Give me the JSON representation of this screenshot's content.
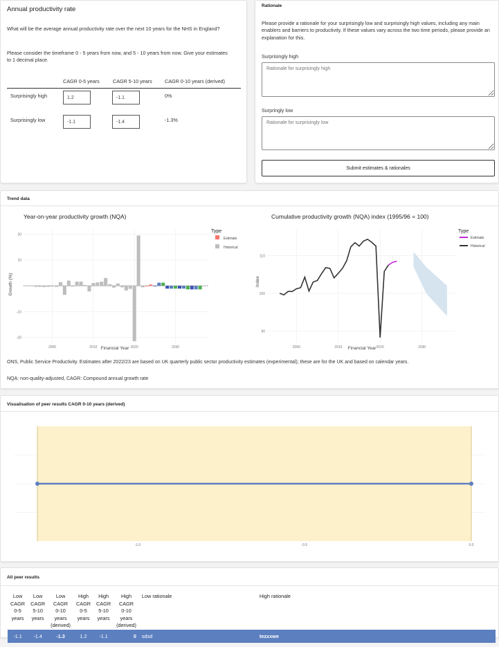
{
  "question": {
    "title": "Annual productivity rate",
    "text1": "What will be the average annual productivity rate over the next 10 years for the NHS in England?",
    "text2": "Please consider the timeframe 0 - 5 years from now, and 5 - 10 years from now. Give your estimates to 1 decimal place.",
    "columns": [
      "CAGR 0-5 years",
      "CAGR 5-10 years",
      "CAGR 0-10 years (derived)"
    ],
    "rows": [
      {
        "label": "Surprisingly high",
        "cagr_0_5": "1.2",
        "cagr_5_10": "-1.1",
        "derived": "0%"
      },
      {
        "label": "Surprisingly low",
        "cagr_0_5": "-1.1",
        "cagr_5_10": "-1.4",
        "derived": "-1.3%"
      }
    ]
  },
  "rationale": {
    "title": "Rationale",
    "text": "Please provide a rationale for your surprisingly low and surprisingly high values, including any main enablers and barriers to productivity. If these values vary across the two time periods, please provide an explanation for this.",
    "high_label": "Surprisingly high",
    "high_placeholder": "Rationale for surprisingly high",
    "low_label": "Surpringly low",
    "low_placeholder": "Rationale for surprisingly low",
    "submit_label": "Submit estimates & rationales"
  },
  "trend": {
    "section_title": "Trend data",
    "footnote1": "ONS, Public Service Productivity. Estimates after 2022/23 are based on UK quarterly public sector productivity estimates (experimental); these are for the UK and based on calendar years.",
    "footnote2": "NQA: non-quality-adjusted, CAGR: Compound annual growth rate"
  },
  "colors": {
    "estimate_bar": "#f8766d",
    "historical": "#bdbdbd",
    "estimate_line": "#c026d3",
    "line": "#333333",
    "ribbon": "#d6e4f0",
    "band": "#fdf1cc",
    "peer_line": "#5b7fbf",
    "row_bg": "#5b7fbf"
  },
  "chart_data": [
    {
      "type": "bar",
      "title": "Year-on-year productivity growth (NQA)",
      "xlabel": "Financial Year",
      "ylabel": "Growth (%)",
      "ylim": [
        -22,
        22
      ],
      "yticks": [
        -20,
        -10,
        10,
        20
      ],
      "xticks": [
        2000,
        2010,
        2020,
        2030
      ],
      "legend_title": "Type",
      "legend": [
        "Estimate",
        "Historical"
      ],
      "series": [
        {
          "name": "Historical",
          "x": [
            1996,
            1997,
            1998,
            1999,
            2000,
            2001,
            2002,
            2003,
            2004,
            2005,
            2006,
            2007,
            2008,
            2009,
            2010,
            2011,
            2012,
            2013,
            2014,
            2015,
            2016,
            2017,
            2018,
            2019,
            2020,
            2021,
            2022
          ],
          "values": [
            -0.4,
            -0.4,
            -0.5,
            -0.4,
            -0.3,
            -0.4,
            1.4,
            -3.5,
            2.0,
            -0.3,
            1.6,
            1.6,
            0.3,
            -2.2,
            1.1,
            1.3,
            1.6,
            3.0,
            0.6,
            -0.7,
            0.9,
            -0.6,
            -1.8,
            -1.2,
            -21.5,
            19.5,
            -0.6
          ]
        },
        {
          "name": "Estimate",
          "x": [
            2023,
            2024,
            2025,
            2026,
            2027,
            2028,
            2029,
            2030,
            2031,
            2032,
            2033,
            2034,
            2035,
            2036
          ],
          "values": [
            -0.1,
            0.5,
            -0.1,
            1.2,
            1.2,
            -1.1,
            -1.1,
            -1.1,
            -1.1,
            -1.1,
            -1.4,
            -1.4,
            -1.4,
            -1.4
          ]
        }
      ]
    },
    {
      "type": "line",
      "title": "Cumulative productivity growth (NQA) index (1995/96 = 100)",
      "xlabel": "Financial Year",
      "ylabel": "Index",
      "ylim": [
        87,
        117
      ],
      "yticks": [
        90,
        100,
        110
      ],
      "xticks": [
        2000,
        2010,
        2020,
        2030
      ],
      "legend_title": "Type",
      "legend": [
        "Estimate",
        "Historical"
      ],
      "series": [
        {
          "name": "Historical",
          "x": [
            1996,
            1997,
            1998,
            1999,
            2000,
            2001,
            2002,
            2003,
            2004,
            2005,
            2006,
            2007,
            2008,
            2009,
            2010,
            2011,
            2012,
            2013,
            2014,
            2015,
            2016,
            2017,
            2018,
            2019,
            2020,
            2021,
            2022
          ],
          "values": [
            100.0,
            99.6,
            100.5,
            100.5,
            101.2,
            101.5,
            104.3,
            100.6,
            103.0,
            103.4,
            105.2,
            106.8,
            106.6,
            104.1,
            105.3,
            106.6,
            108.6,
            112.3,
            113.4,
            112.5,
            113.8,
            114.3,
            113.5,
            112.5,
            88.3,
            105.8,
            107.5
          ]
        },
        {
          "name": "Estimate",
          "x": [
            2022,
            2023,
            2024
          ],
          "values": [
            107.5,
            108.2,
            108.5
          ]
        }
      ],
      "ribbon": {
        "x": [
          2028,
          2031,
          2036
        ],
        "upper": [
          111,
          107,
          102
        ],
        "lower": [
          107,
          100,
          94
        ]
      }
    },
    {
      "type": "line",
      "title": "Visualisation of peer results CAGR 0-10 years (derived)",
      "xlim": [
        -1.3,
        0.0
      ],
      "xticks": [
        -1.0,
        -0.5,
        0.0
      ],
      "series": [
        {
          "name": "Peer range",
          "x": [
            -1.3,
            0.0
          ],
          "values": [
            0.5,
            0.5
          ]
        }
      ]
    }
  ],
  "peer": {
    "section_title": "All peer results",
    "headers": [
      "Low CAGR 0-5 years",
      "Low CAGR 5-10 years",
      "Low CAGR 0-10 years (derived)",
      "High CAGR 0-5 years",
      "High CAGR 5-10 years",
      "High CAGR 0-10 years (derived)",
      "Low rationale",
      "High rationale"
    ],
    "row": [
      "-1.1",
      "-1.4",
      "-1.3",
      "1.2",
      "-1.1",
      "0",
      "sdsd",
      "tezxxwe"
    ]
  }
}
